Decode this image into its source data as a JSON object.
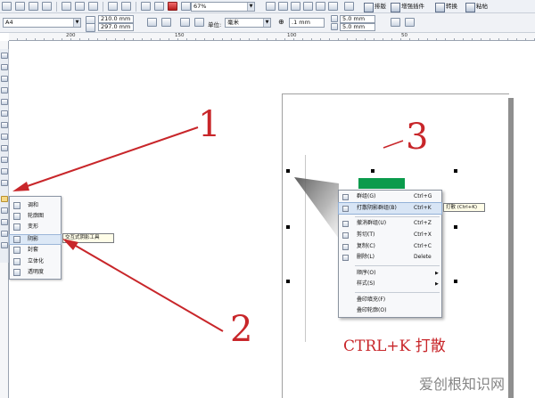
{
  "toolbar": {
    "zoom_value": "67%",
    "btn_layout": "排版",
    "btn_plugin": "增强插件",
    "btn_convert": "转换",
    "btn_paste": "粘帖",
    "page_size": "A4",
    "width": "210.0 mm",
    "height": "297.0 mm",
    "unit_label": "单位:",
    "unit_value": "毫米",
    "nudge": ".1 mm",
    "dup_x": "5.0 mm",
    "dup_y": "5.0 mm"
  },
  "ruler": {
    "labels": [
      "200",
      "150",
      "100",
      "50"
    ]
  },
  "flyout": {
    "items": [
      "调和",
      "轮廓图",
      "变形",
      "阴影",
      "封套",
      "立体化",
      "透明度"
    ],
    "tooltip": "交互式阴影工具"
  },
  "context_menu": {
    "items": [
      {
        "label": "群组(G)",
        "shortcut": "Ctrl+G"
      },
      {
        "label": "打散阴影群组(B)",
        "shortcut": "Ctrl+K"
      },
      {
        "label": "撤消群组(U)",
        "shortcut": "Ctrl+Z"
      },
      {
        "label": "剪切(T)",
        "shortcut": "Ctrl+X"
      },
      {
        "label": "复制(C)",
        "shortcut": "Ctrl+C"
      },
      {
        "label": "删除(L)",
        "shortcut": "Delete"
      },
      {
        "label": "顺序(O)",
        "shortcut": ""
      },
      {
        "label": "样式(S)",
        "shortcut": ""
      },
      {
        "label": "叠印填充(F)",
        "shortcut": ""
      },
      {
        "label": "叠印轮廓(O)",
        "shortcut": ""
      }
    ],
    "tooltip": "打散 (Ctrl+K)"
  },
  "annotations": {
    "step1": "1",
    "step2": "2",
    "step3": "3",
    "caption": "CTRL+K 打散",
    "color": "#c8262a"
  },
  "watermark": "爱创根知识网",
  "colors": {
    "shape_fill": "#0b9b4c",
    "highlight": "#d8e5f5"
  }
}
